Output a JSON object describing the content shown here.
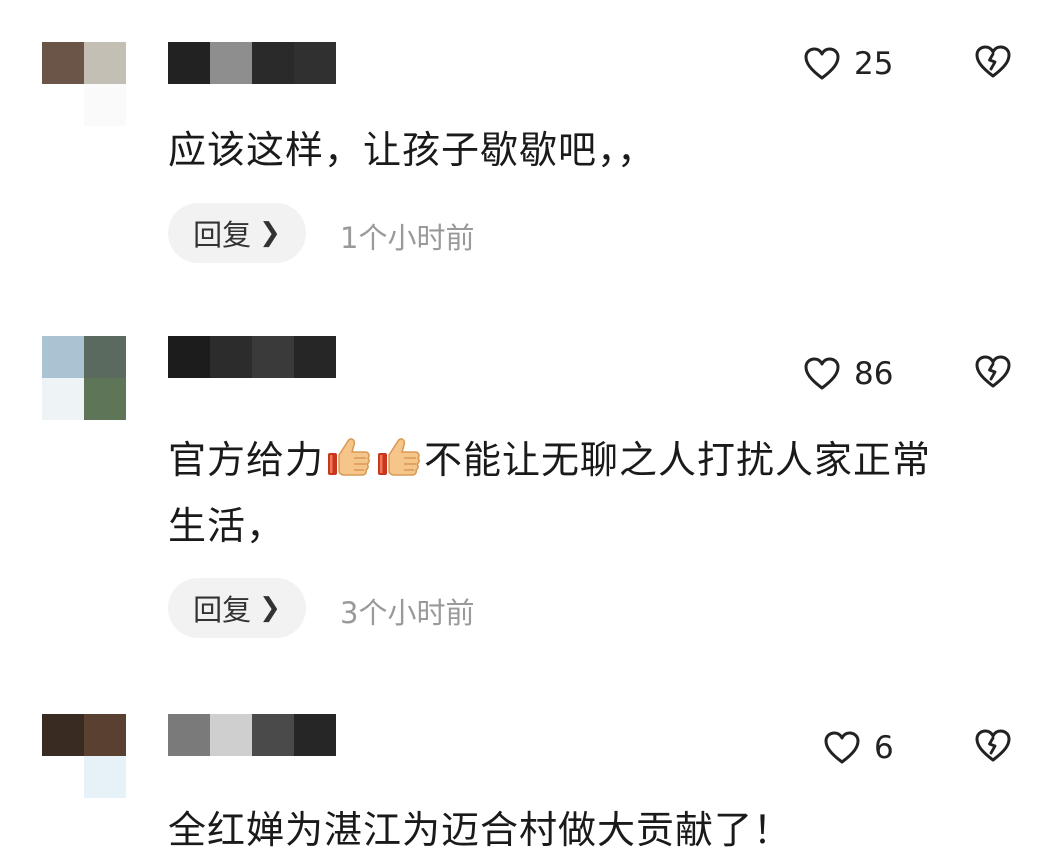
{
  "comments": [
    {
      "likes": "25",
      "text_lines": [
        "应该这样，让孩子歇歇吧，，"
      ],
      "reply_label": "回复",
      "time": "1个小时前",
      "avatar_colors": [
        "#6b5548",
        "#c4bfb4",
        "#fafafa",
        "#ffffff"
      ],
      "name_colors": [
        "#222222",
        "#8e8e8e",
        "#2a2a2a",
        "#303030"
      ]
    },
    {
      "likes": "86",
      "text_parts": [
        "官方给力",
        "不能让无聊之人打扰人家正常"
      ],
      "text_line2": "生活，",
      "emoji": [
        "thumbs-up",
        "thumbs-up"
      ],
      "reply_label": "回复",
      "time": "3个小时前",
      "avatar_colors": [
        "#a9c3d2",
        "#5a6a5e",
        "#eef3f6",
        "#5e7558"
      ],
      "name_colors": [
        "#1c1c1c",
        "#2c2c2c",
        "#3a3a3a",
        "#262626"
      ]
    },
    {
      "likes": "6",
      "text_lines": [
        "全红婵为湛江为迈合村做大贡献了！"
      ],
      "avatar_colors": [
        "#3a2b22",
        "#5a4030",
        "#ffffff",
        "#e6f1f8"
      ],
      "name_colors": [
        "#7a7a7a",
        "#cfcfcf",
        "#4a4a4a",
        "#262626"
      ]
    }
  ]
}
